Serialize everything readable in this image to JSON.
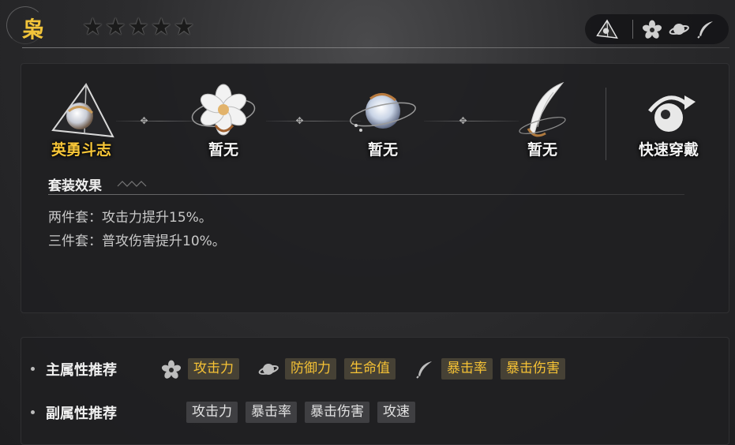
{
  "header": {
    "character_name": "枭",
    "stars": [
      "★",
      "★",
      "★",
      "★",
      "★"
    ],
    "filter_icons": [
      "pyramid-icon",
      "flower-icon",
      "planet-icon",
      "feather-icon"
    ]
  },
  "slots": [
    {
      "label": "英勇斗志",
      "icon": "pyramid-orb-icon",
      "active": true
    },
    {
      "label": "暂无",
      "icon": "flower-icon",
      "active": false
    },
    {
      "label": "暂无",
      "icon": "planet-orb-icon",
      "active": false
    },
    {
      "label": "暂无",
      "icon": "feather-icon",
      "active": false
    }
  ],
  "quick_equip": {
    "label": "快速穿戴",
    "icon": "quick-equip-icon"
  },
  "set_effects": {
    "title": "套装效果",
    "lines": [
      "两件套：攻击力提升15%。",
      "三件套：普攻伤害提升10%。"
    ]
  },
  "recommendations": {
    "main": {
      "label": "主属性推荐",
      "groups": [
        {
          "icon": "flower-icon",
          "tags": [
            "攻击力"
          ]
        },
        {
          "icon": "planet-icon",
          "tags": [
            "防御力",
            "生命值"
          ]
        },
        {
          "icon": "feather-icon",
          "tags": [
            "暴击率",
            "暴击伤害"
          ]
        }
      ]
    },
    "sub": {
      "label": "副属性推荐",
      "tags": [
        "攻击力",
        "暴击率",
        "暴击伤害",
        "攻速"
      ]
    }
  },
  "colors": {
    "accent_gold": "#f6c235",
    "panel": "#202022"
  }
}
